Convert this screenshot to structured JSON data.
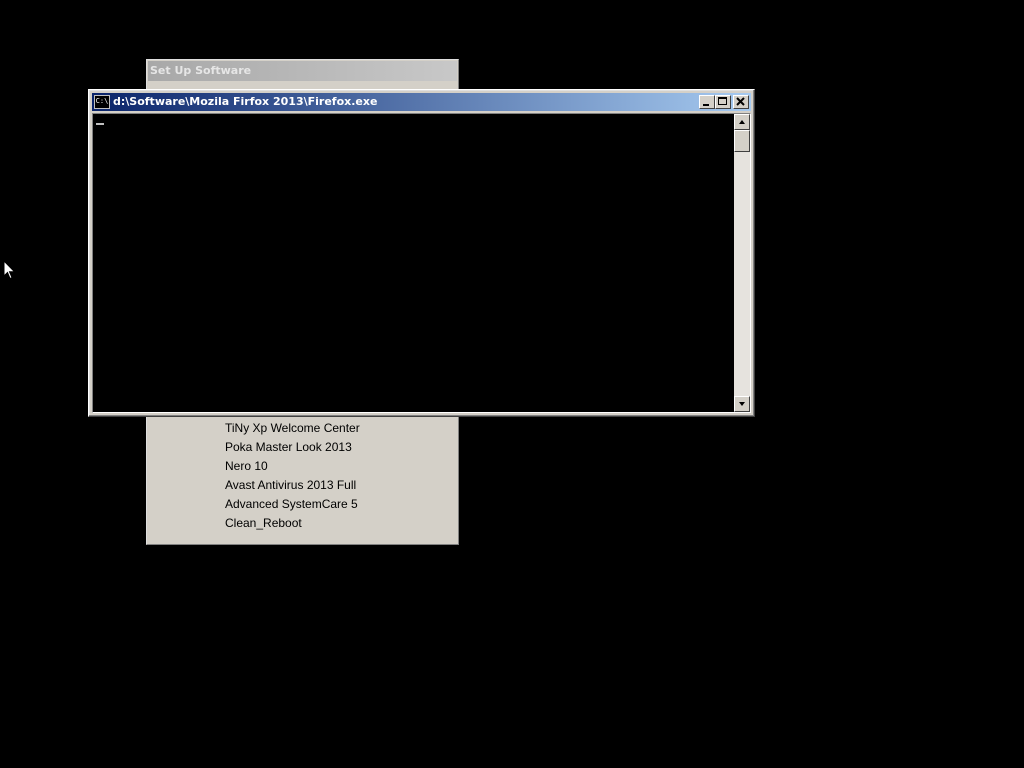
{
  "setup_window": {
    "title": "Set Up Software",
    "items": [
      "TiNy  Xp Welcome Center",
      "Poka Master Look 2013",
      "Nero 10",
      "Avast Antivirus 2013 Full",
      "Advanced SystemCare 5",
      "Clean_Reboot"
    ]
  },
  "console_window": {
    "icon": "console-icon",
    "icon_label": "C:\\",
    "title": "d:\\Software\\Mozila Firfox 2013\\Firefox.exe",
    "buttons": {
      "minimize": "minimize-icon",
      "maximize": "maximize-icon",
      "close": "close-icon"
    }
  },
  "desktop": {
    "background_color": "#000000",
    "pointer": "mouse-pointer-icon"
  },
  "colors": {
    "title_active_start": "#0a246a",
    "title_active_end": "#a6caf0",
    "window_face": "#d4d0c8"
  }
}
